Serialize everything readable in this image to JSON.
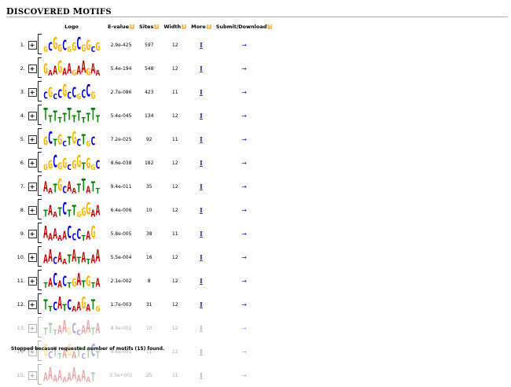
{
  "heading": {
    "first": "D",
    "rest": "ISCOVERED ",
    "first2": "M",
    "rest2": "OTIFS"
  },
  "columns": {
    "logo": "Logo",
    "evalue": "E-value",
    "sites": "Sites",
    "width": "Width",
    "more": "More",
    "submit": "Submit/Download",
    "help": "?"
  },
  "toggle_symbol": "+",
  "more_symbol": "I",
  "submit_symbol": "→",
  "colors": {
    "A": "#cc0000",
    "C": "#0000cc",
    "G": "#ffb300",
    "T": "#008000"
  },
  "motifs": [
    {
      "num": "1.",
      "evalue": "2.9e-425",
      "sites": "597",
      "width": "12",
      "logo": "GCGGCGGCGGCG",
      "faded": false
    },
    {
      "num": "2.",
      "evalue": "5.4e-194",
      "sites": "548",
      "width": "12",
      "logo": "GAAGAAGAAGAA",
      "faded": false
    },
    {
      "num": "3.",
      "evalue": "2.7e-086",
      "sites": "423",
      "width": "11",
      "logo": "CGCCGCCGCCG",
      "faded": false
    },
    {
      "num": "4.",
      "evalue": "5.4e-045",
      "sites": "134",
      "width": "12",
      "logo": "TTTTTTTTTTTT",
      "faded": false
    },
    {
      "num": "5.",
      "evalue": "7.2e-025",
      "sites": "92",
      "width": "11",
      "logo": "GCTGCTGCTGC",
      "faded": false
    },
    {
      "num": "6.",
      "evalue": "8.6e-038",
      "sites": "182",
      "width": "12",
      "logo": "GGCGGCGGTGGC",
      "faded": false
    },
    {
      "num": "7.",
      "evalue": "9.4e-011",
      "sites": "35",
      "width": "12",
      "logo": "AATGCAATTATT",
      "faded": false
    },
    {
      "num": "8.",
      "evalue": "6.4e-006",
      "sites": "10",
      "width": "12",
      "logo": "TAATCTTGGGAA",
      "faded": false
    },
    {
      "num": "9.",
      "evalue": "5.8e-005",
      "sites": "38",
      "width": "11",
      "logo": "AAAAACCCTAG",
      "faded": false
    },
    {
      "num": "10.",
      "evalue": "5.5e-004",
      "sites": "16",
      "width": "12",
      "logo": "AACAATATATAA",
      "faded": false
    },
    {
      "num": "11.",
      "evalue": "2.1e-002",
      "sites": "8",
      "width": "12",
      "logo": "TACACTGATGTA",
      "faded": false
    },
    {
      "num": "12.",
      "evalue": "1.7e-003",
      "sites": "31",
      "width": "12",
      "logo": "TTCATCAAGATG",
      "faded": false
    },
    {
      "num": "13.",
      "evalue": "8.4e-002",
      "sites": "10",
      "width": "12",
      "logo": "TTTAAGCCAATA",
      "faded": true
    },
    {
      "num": "14.",
      "evalue": "4.4e-001",
      "sites": "11",
      "width": "12",
      "logo": "GCTTAGATCTCT",
      "faded": true
    },
    {
      "num": "15.",
      "evalue": "2.3e+001",
      "sites": "25",
      "width": "11",
      "logo": "AAAAAAAAAAT",
      "faded": true
    }
  ],
  "footer": "Stopped because requested number of motifs (15) found."
}
